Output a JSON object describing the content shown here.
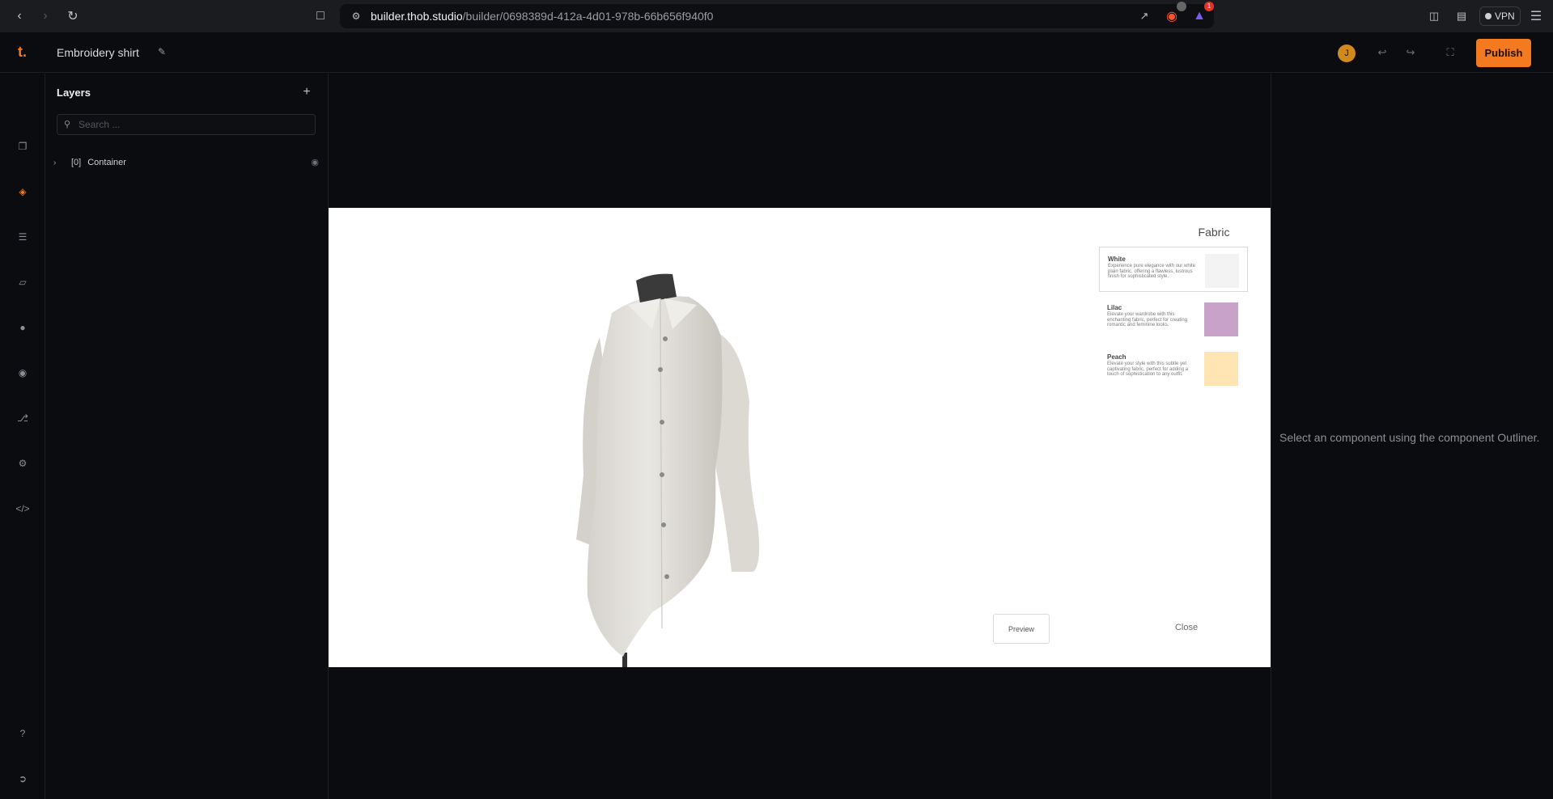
{
  "browser": {
    "url_domain": "builder.thob.studio",
    "url_path": "/builder/0698389d-412a-4d01-978b-66b656f940f0",
    "brave_badge": "",
    "rewards_badge": "1",
    "vpn_label": "VPN"
  },
  "topbar": {
    "logo": "t.",
    "title": "Embroidery shirt",
    "avatar_initial": "J",
    "publish_label": "Publish",
    "accent_color": "#f37a1f"
  },
  "rail": {
    "icons": [
      "pages-icon",
      "layers-icon",
      "sliders-icon",
      "cube-icon",
      "drop-icon",
      "palette-icon",
      "branch-icon",
      "gear-icon",
      "code-icon",
      "help-icon",
      "logout-icon"
    ]
  },
  "layers": {
    "title": "Layers",
    "search_placeholder": "Search ...",
    "items": [
      {
        "index": "[0]",
        "label": "Container"
      }
    ]
  },
  "configurator": {
    "fabric_title": "Fabric",
    "fabrics": [
      {
        "name": "White",
        "desc": "Experience pure elegance with our white plain fabric, offering a flawless, lustrous finish for sophisticated style.",
        "color": "#f3f3f3"
      },
      {
        "name": "Lilac",
        "desc": "Elevate your wardrobe with this enchanting fabric, perfect for creating romantic and feminine looks.",
        "color": "#c8a2c8"
      },
      {
        "name": "Peach",
        "desc": "Elevate your style with this subtle yet captivating fabric, perfect for adding a touch of sophistication to any outfit.",
        "color": "#ffe5b4"
      }
    ],
    "preview_label": "Preview",
    "close_label": "Close"
  },
  "right_panel": {
    "message": "Select an component using the component Outliner."
  }
}
